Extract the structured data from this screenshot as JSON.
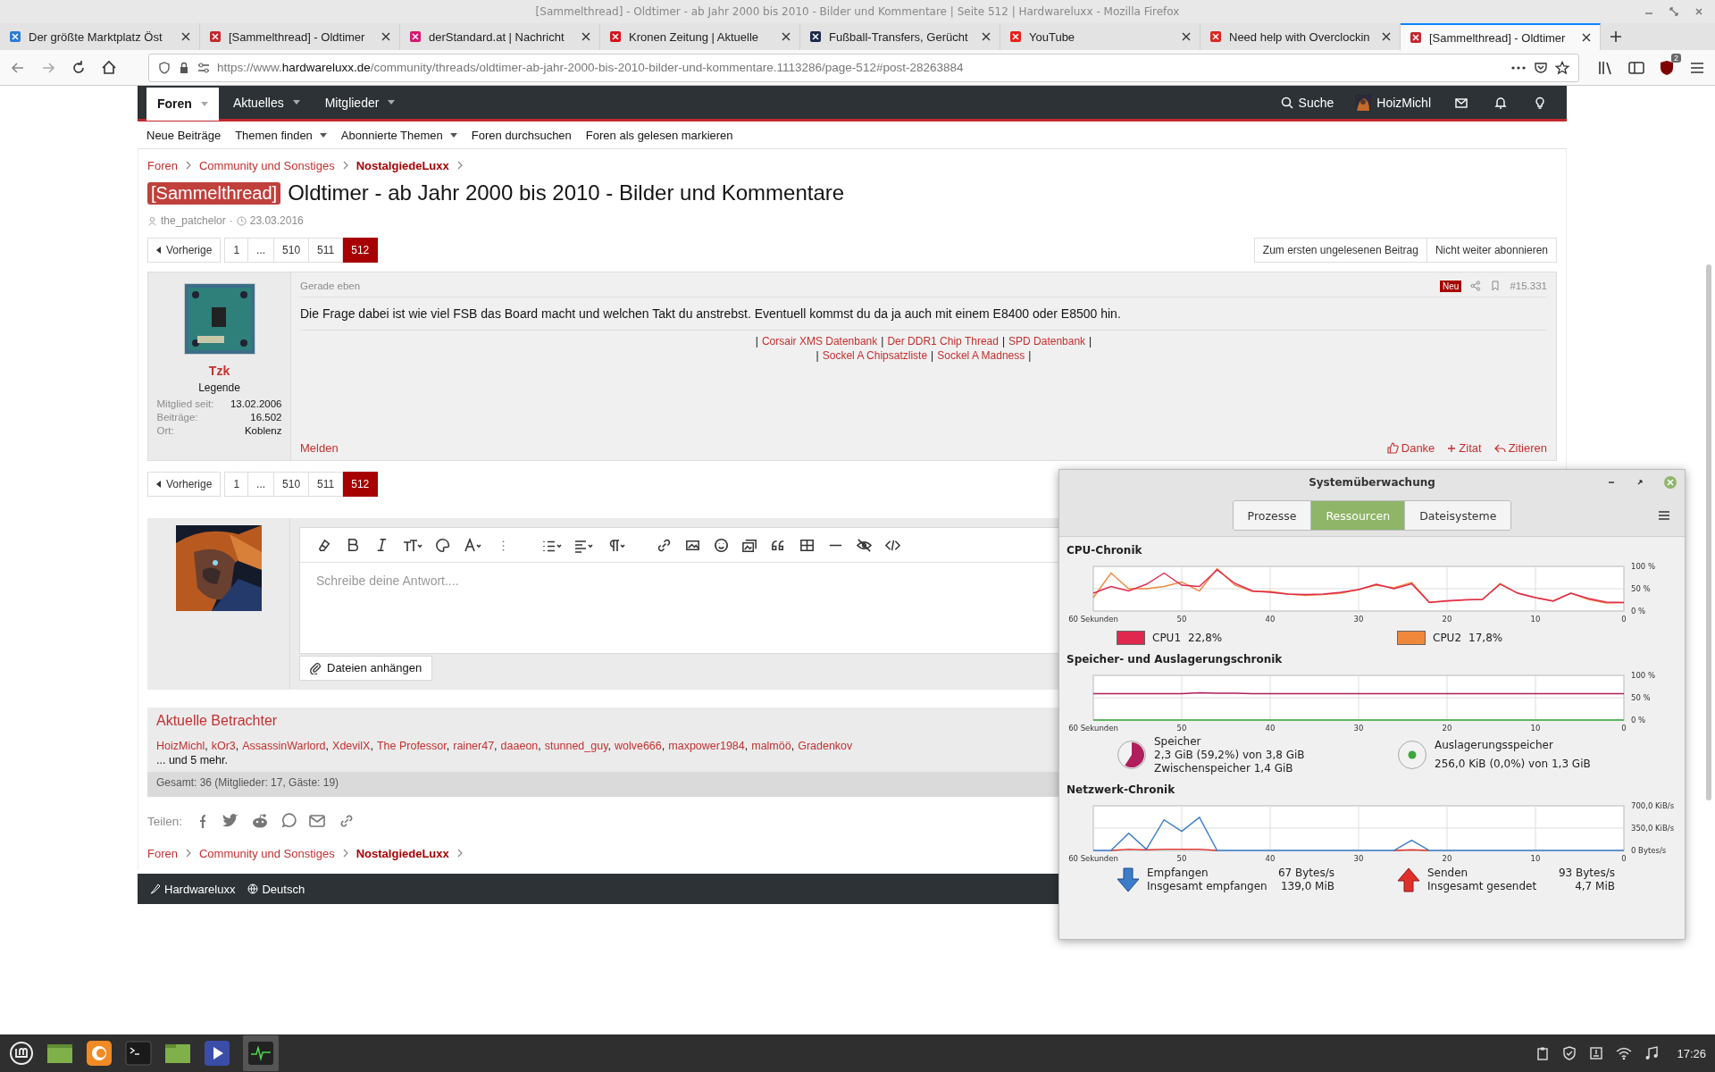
{
  "window": {
    "title": "[Sammelthread] - Oldtimer - ab Jahr 2000 bis 2010 - Bilder und Kommentare | Seite 512 | Hardwareluxx - Mozilla Firefox"
  },
  "browser": {
    "tabs": [
      {
        "title": "Der größte Marktplatz Öst",
        "selected": false
      },
      {
        "title": "[Sammelthread] - Oldtimer",
        "selected": false
      },
      {
        "title": "derStandard.at | Nachricht",
        "selected": false
      },
      {
        "title": "Kronen Zeitung | Aktuelle",
        "selected": false
      },
      {
        "title": "Fußball-Transfers, Gerücht",
        "selected": false
      },
      {
        "title": "YouTube",
        "selected": false
      },
      {
        "title": "Need help with Overclockin",
        "selected": false
      },
      {
        "title": "[Sammelthread] - Oldtimer",
        "selected": true
      }
    ],
    "url": "https://www.**hardwareluxx.de**/community/threads/oldtimer-ab-jahr-2000-bis-2010-bilder-und-kommentare.1113286/page-512#post-28263884",
    "addon_badge": "2"
  },
  "forum": {
    "nav": [
      {
        "label": "Foren",
        "selected": true
      },
      {
        "label": "Aktuelles",
        "selected": false
      },
      {
        "label": "Mitglieder",
        "selected": false
      }
    ],
    "search": "Suche",
    "user": "HoizMichl",
    "subnav": [
      {
        "label": "Neue Beiträge",
        "dropdown": false
      },
      {
        "label": "Themen finden",
        "dropdown": true
      },
      {
        "label": "Abonnierte Themen",
        "dropdown": true
      },
      {
        "label": "Foren durchsuchen",
        "dropdown": false
      },
      {
        "label": "Foren als gelesen markieren",
        "dropdown": false
      }
    ],
    "breadcrumb": [
      {
        "label": "Foren",
        "current": false
      },
      {
        "label": "Community und Sonstiges",
        "current": false
      },
      {
        "label": "NostalgiedeLuxx",
        "current": true
      }
    ],
    "thread": {
      "prefix": "[Sammelthread]",
      "title": "Oldtimer - ab Jahr 2000 bis 2010 - Bilder und Kommentare",
      "author": "the_patchelor",
      "separator": "·",
      "date": "23.03.2016"
    },
    "pagination": {
      "prev": "Vorherige",
      "pages": [
        {
          "label": "1",
          "selected": false
        },
        {
          "label": "...",
          "selected": false
        },
        {
          "label": "510",
          "selected": false
        },
        {
          "label": "511",
          "selected": false
        },
        {
          "label": "512",
          "selected": true
        }
      ]
    },
    "thread_actions": [
      "Zum ersten ungelesenen Beitrag",
      "Nicht weiter abonnieren"
    ],
    "post": {
      "user": "Tzk",
      "rank": "Legende",
      "stats": [
        {
          "label": "Mitglied seit:",
          "value": "13.02.2006"
        },
        {
          "label": "Beiträge:",
          "value": "16.502"
        },
        {
          "label": "Ort:",
          "value": "Koblenz"
        }
      ],
      "time": "Gerade eben",
      "badge": "Neu",
      "number": "#15.331",
      "text": "Die Frage dabei ist wie viel FSB das Board macht und welchen Takt du anstrebst. Eventuell kommst du da ja auch mit einem E8400 oder E8500 hin.",
      "signature": [
        [
          {
            "kind": "sep",
            "text": "|"
          },
          {
            "kind": "link",
            "text": "Corsair XMS Datenbank"
          },
          {
            "kind": "sep",
            "text": "|"
          },
          {
            "kind": "link",
            "text": "Der DDR1 Chip Thread"
          },
          {
            "kind": "sep",
            "text": "|"
          },
          {
            "kind": "link",
            "text": "SPD Datenbank"
          },
          {
            "kind": "sep",
            "text": "|"
          }
        ],
        [
          {
            "kind": "sep",
            "text": "|"
          },
          {
            "kind": "link",
            "text": "Sockel A Chipsatzliste"
          },
          {
            "kind": "sep",
            "text": "|"
          },
          {
            "kind": "link",
            "text": "Sockel A Madness"
          },
          {
            "kind": "sep",
            "text": "|"
          }
        ]
      ],
      "report": "Melden",
      "actions": [
        {
          "kind": "like",
          "label": "Danke"
        },
        {
          "kind": "plus",
          "label": "Zitat"
        },
        {
          "kind": "reply",
          "label": "Zitieren"
        }
      ]
    },
    "pagination_bottom": {
      "prev": "Vorherige",
      "pages": [
        {
          "label": "1",
          "selected": false
        },
        {
          "label": "...",
          "selected": false
        },
        {
          "label": "510",
          "selected": false
        },
        {
          "label": "511",
          "selected": false
        },
        {
          "label": "512",
          "selected": true
        }
      ]
    },
    "reply": {
      "placeholder": "Schreibe deine Antwort....",
      "attach": "Dateien anhängen"
    },
    "viewers": {
      "title": "Aktuelle Betrachter",
      "names": [
        {
          "name": "HoizMichl",
          "sep": ","
        },
        {
          "name": "kOr3",
          "sep": ","
        },
        {
          "name": "AssassinWarlord",
          "sep": ","
        },
        {
          "name": "XdevilX",
          "sep": ","
        },
        {
          "name": "The Professor",
          "sep": ","
        },
        {
          "name": "rainer47",
          "sep": ","
        },
        {
          "name": "daaeon",
          "sep": ","
        },
        {
          "name": "stunned_guy",
          "sep": ","
        },
        {
          "name": "wolve666",
          "sep": ","
        },
        {
          "name": "maxpower1984",
          "sep": ","
        },
        {
          "name": "malmöö",
          "sep": ","
        },
        {
          "name": "Gradenkov"
        }
      ],
      "more": "... und 5 mehr.",
      "total": "Gesamt: 36 (Mitglieder: 17, Gäste: 19)"
    },
    "share": "Teilen:",
    "breadcrumb_bottom": [
      {
        "label": "Foren",
        "current": false
      },
      {
        "label": "Community und Sonstiges",
        "current": false
      },
      {
        "label": "NostalgiedeLuxx",
        "current": true
      }
    ],
    "footer": [
      "Hardwareluxx",
      "Deutsch"
    ]
  },
  "monitor": {
    "title": "Systemüberwachung",
    "tabs": [
      {
        "label": "Prozesse",
        "selected": false
      },
      {
        "label": "Ressourcen",
        "selected": true
      },
      {
        "label": "Dateisysteme",
        "selected": false
      }
    ],
    "cpu": {
      "title": "CPU-Chronik",
      "readings": [
        "22,8%",
        "17,8%"
      ],
      "chart_data": {
        "type": "line",
        "grid": true,
        "x": [
          60,
          58,
          56,
          54,
          52,
          50,
          48,
          46,
          44,
          42,
          40,
          38,
          36,
          34,
          32,
          30,
          28,
          26,
          24,
          22,
          20,
          18,
          16,
          14,
          12,
          10,
          8,
          6,
          4,
          2,
          0
        ],
        "xlim": [
          60,
          0
        ],
        "ylim": [
          0,
          100
        ],
        "xticks": [
          {
            "value": 60,
            "label": "60 Sekunden"
          },
          50,
          40,
          30,
          20,
          10,
          0
        ],
        "yticks": [
          {
            "value": 0,
            "label": "0 %"
          },
          {
            "value": 50,
            "label": "50 %"
          },
          {
            "value": 100,
            "label": "100 %"
          }
        ],
        "series": [
          {
            "name": "CPU1",
            "color": "#e0284f",
            "values": [
              40,
              55,
              45,
              60,
              85,
              58,
              55,
              92,
              62,
              45,
              42,
              38,
              37,
              38,
              42,
              48,
              60,
              50,
              61,
              19,
              23,
              25,
              26,
              60,
              40,
              30,
              22,
              40,
              28,
              20,
              19
            ]
          },
          {
            "name": "CPU2",
            "color": "#f0883c",
            "values": [
              30,
              85,
              50,
              50,
              55,
              65,
              45,
              95,
              58,
              44,
              44,
              38,
              35,
              37,
              40,
              48,
              58,
              52,
              64,
              20,
              22,
              25,
              26,
              62,
              40,
              30,
              23,
              40,
              26,
              18,
              19
            ]
          }
        ]
      }
    },
    "memory": {
      "title": "Speicher- und Auslagerungschronik",
      "gauges": [
        {
          "lines": [
            "2,3 GiB (59,2%) von 3,8 GiB",
            "Zwischenspeicher 1,4 GiB"
          ],
          "level": 0.592
        },
        {
          "lines": [
            "256,0 KiB (0,0%) von 1,3 GiB"
          ]
        }
      ],
      "chart_data": {
        "type": "line",
        "grid": true,
        "x": [
          60,
          58,
          56,
          54,
          52,
          50,
          48,
          46,
          44,
          42,
          40,
          38,
          36,
          34,
          32,
          30,
          28,
          26,
          24,
          22,
          20,
          18,
          16,
          14,
          12,
          10,
          8,
          6,
          4,
          2,
          0
        ],
        "xlim": [
          60,
          0
        ],
        "ylim": [
          0,
          100
        ],
        "xticks": [
          {
            "value": 60,
            "label": "60 Sekunden"
          },
          50,
          40,
          30,
          20,
          10,
          0
        ],
        "yticks": [
          {
            "value": 0,
            "label": "0 %"
          },
          {
            "value": 50,
            "label": "50 %"
          },
          {
            "value": 100,
            "label": "100 %"
          }
        ],
        "series": [
          {
            "name": "Speicher",
            "color": "#b01e5c",
            "values": [
              59,
              59,
              59,
              59,
              59,
              59,
              61,
              60,
              60,
              59,
              59,
              59,
              59,
              59,
              59,
              59,
              59,
              59,
              59,
              59,
              59,
              59,
              59,
              59,
              59,
              59,
              59,
              59,
              59,
              59,
              59
            ]
          },
          {
            "name": "Auslagerungsspeicher",
            "color": "#3aa83a",
            "values": [
              0,
              0,
              0,
              0,
              0,
              0,
              0,
              0,
              0,
              0,
              0,
              0,
              0,
              0,
              0,
              0,
              0,
              0,
              0,
              0,
              0,
              0,
              0,
              0,
              0,
              0,
              0,
              0,
              0,
              0,
              0
            ]
          }
        ]
      }
    },
    "network": {
      "title": "Netzwerk-Chronik",
      "stats": [
        {
          "kind": "receive",
          "rate": "67 Bytes/s",
          "total_label": "Insgesamt empfangen",
          "total": "139,0 MiB"
        },
        {
          "kind": "send",
          "rate": "93 Bytes/s",
          "total_label": "Insgesamt gesendet",
          "total": "4,7 MiB"
        }
      ],
      "chart_data": {
        "type": "line",
        "grid": true,
        "x": [
          60,
          58,
          56,
          54,
          52,
          50,
          48,
          46,
          44,
          42,
          40,
          38,
          36,
          34,
          32,
          30,
          28,
          26,
          24,
          22,
          20,
          18,
          16,
          14,
          12,
          10,
          8,
          6,
          4,
          2,
          0
        ],
        "xlim": [
          60,
          0
        ],
        "ylim": [
          0,
          700
        ],
        "xticks": [
          {
            "value": 60,
            "label": "60 Sekunden"
          },
          50,
          40,
          30,
          20,
          10,
          0
        ],
        "yticks": [
          {
            "value": 0,
            "label": "0 Bytes/s"
          },
          {
            "value": 350,
            "label": "350,0 KiB/s"
          },
          {
            "value": 700,
            "label": "700,0 KiB/s"
          }
        ],
        "series": [
          {
            "name": "Empfangen",
            "color": "#3b7dc8",
            "values": [
              0,
              0,
              270,
              20,
              480,
              300,
              520,
              0,
              0,
              0,
              0,
              0,
              0,
              0,
              0,
              0,
              0,
              0,
              160,
              0,
              0,
              0,
              0,
              0,
              0,
              0,
              0,
              0,
              0,
              0,
              0
            ]
          },
          {
            "name": "Senden",
            "color": "#e0302a",
            "values": [
              null,
              0,
              20,
              10,
              20,
              20,
              20,
              0,
              null,
              null,
              null,
              null,
              null,
              null,
              null,
              null,
              null,
              0,
              10,
              0,
              null,
              null,
              null,
              null,
              null,
              null,
              null,
              null,
              null,
              null,
              null
            ]
          }
        ]
      }
    }
  },
  "taskbar": {
    "clock": "17:26"
  }
}
